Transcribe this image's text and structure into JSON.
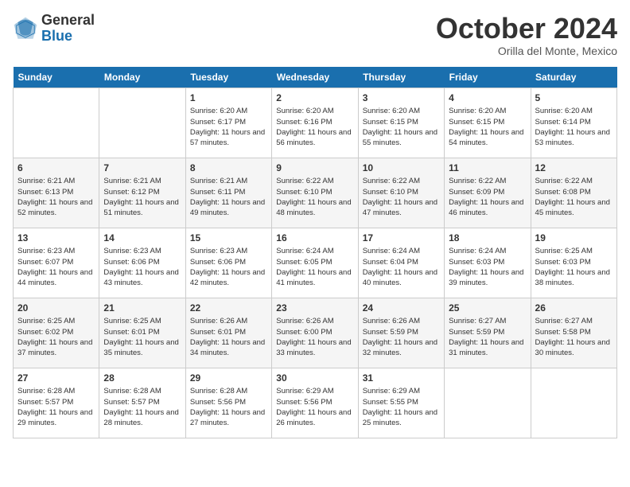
{
  "logo": {
    "general": "General",
    "blue": "Blue"
  },
  "header": {
    "month": "October 2024",
    "location": "Orilla del Monte, Mexico"
  },
  "days_of_week": [
    "Sunday",
    "Monday",
    "Tuesday",
    "Wednesday",
    "Thursday",
    "Friday",
    "Saturday"
  ],
  "weeks": [
    [
      {
        "day": "",
        "info": ""
      },
      {
        "day": "",
        "info": ""
      },
      {
        "day": "1",
        "info": "Sunrise: 6:20 AM\nSunset: 6:17 PM\nDaylight: 11 hours and 57 minutes."
      },
      {
        "day": "2",
        "info": "Sunrise: 6:20 AM\nSunset: 6:16 PM\nDaylight: 11 hours and 56 minutes."
      },
      {
        "day": "3",
        "info": "Sunrise: 6:20 AM\nSunset: 6:15 PM\nDaylight: 11 hours and 55 minutes."
      },
      {
        "day": "4",
        "info": "Sunrise: 6:20 AM\nSunset: 6:15 PM\nDaylight: 11 hours and 54 minutes."
      },
      {
        "day": "5",
        "info": "Sunrise: 6:20 AM\nSunset: 6:14 PM\nDaylight: 11 hours and 53 minutes."
      }
    ],
    [
      {
        "day": "6",
        "info": "Sunrise: 6:21 AM\nSunset: 6:13 PM\nDaylight: 11 hours and 52 minutes."
      },
      {
        "day": "7",
        "info": "Sunrise: 6:21 AM\nSunset: 6:12 PM\nDaylight: 11 hours and 51 minutes."
      },
      {
        "day": "8",
        "info": "Sunrise: 6:21 AM\nSunset: 6:11 PM\nDaylight: 11 hours and 49 minutes."
      },
      {
        "day": "9",
        "info": "Sunrise: 6:22 AM\nSunset: 6:10 PM\nDaylight: 11 hours and 48 minutes."
      },
      {
        "day": "10",
        "info": "Sunrise: 6:22 AM\nSunset: 6:10 PM\nDaylight: 11 hours and 47 minutes."
      },
      {
        "day": "11",
        "info": "Sunrise: 6:22 AM\nSunset: 6:09 PM\nDaylight: 11 hours and 46 minutes."
      },
      {
        "day": "12",
        "info": "Sunrise: 6:22 AM\nSunset: 6:08 PM\nDaylight: 11 hours and 45 minutes."
      }
    ],
    [
      {
        "day": "13",
        "info": "Sunrise: 6:23 AM\nSunset: 6:07 PM\nDaylight: 11 hours and 44 minutes."
      },
      {
        "day": "14",
        "info": "Sunrise: 6:23 AM\nSunset: 6:06 PM\nDaylight: 11 hours and 43 minutes."
      },
      {
        "day": "15",
        "info": "Sunrise: 6:23 AM\nSunset: 6:06 PM\nDaylight: 11 hours and 42 minutes."
      },
      {
        "day": "16",
        "info": "Sunrise: 6:24 AM\nSunset: 6:05 PM\nDaylight: 11 hours and 41 minutes."
      },
      {
        "day": "17",
        "info": "Sunrise: 6:24 AM\nSunset: 6:04 PM\nDaylight: 11 hours and 40 minutes."
      },
      {
        "day": "18",
        "info": "Sunrise: 6:24 AM\nSunset: 6:03 PM\nDaylight: 11 hours and 39 minutes."
      },
      {
        "day": "19",
        "info": "Sunrise: 6:25 AM\nSunset: 6:03 PM\nDaylight: 11 hours and 38 minutes."
      }
    ],
    [
      {
        "day": "20",
        "info": "Sunrise: 6:25 AM\nSunset: 6:02 PM\nDaylight: 11 hours and 37 minutes."
      },
      {
        "day": "21",
        "info": "Sunrise: 6:25 AM\nSunset: 6:01 PM\nDaylight: 11 hours and 35 minutes."
      },
      {
        "day": "22",
        "info": "Sunrise: 6:26 AM\nSunset: 6:01 PM\nDaylight: 11 hours and 34 minutes."
      },
      {
        "day": "23",
        "info": "Sunrise: 6:26 AM\nSunset: 6:00 PM\nDaylight: 11 hours and 33 minutes."
      },
      {
        "day": "24",
        "info": "Sunrise: 6:26 AM\nSunset: 5:59 PM\nDaylight: 11 hours and 32 minutes."
      },
      {
        "day": "25",
        "info": "Sunrise: 6:27 AM\nSunset: 5:59 PM\nDaylight: 11 hours and 31 minutes."
      },
      {
        "day": "26",
        "info": "Sunrise: 6:27 AM\nSunset: 5:58 PM\nDaylight: 11 hours and 30 minutes."
      }
    ],
    [
      {
        "day": "27",
        "info": "Sunrise: 6:28 AM\nSunset: 5:57 PM\nDaylight: 11 hours and 29 minutes."
      },
      {
        "day": "28",
        "info": "Sunrise: 6:28 AM\nSunset: 5:57 PM\nDaylight: 11 hours and 28 minutes."
      },
      {
        "day": "29",
        "info": "Sunrise: 6:28 AM\nSunset: 5:56 PM\nDaylight: 11 hours and 27 minutes."
      },
      {
        "day": "30",
        "info": "Sunrise: 6:29 AM\nSunset: 5:56 PM\nDaylight: 11 hours and 26 minutes."
      },
      {
        "day": "31",
        "info": "Sunrise: 6:29 AM\nSunset: 5:55 PM\nDaylight: 11 hours and 25 minutes."
      },
      {
        "day": "",
        "info": ""
      },
      {
        "day": "",
        "info": ""
      }
    ]
  ]
}
